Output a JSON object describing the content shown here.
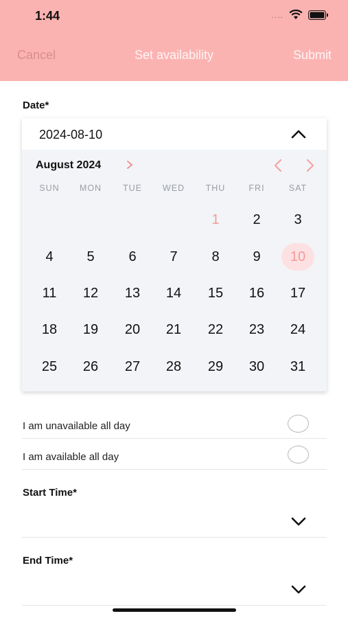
{
  "status_bar": {
    "time": "1:44",
    "dots": "....",
    "wifi_icon": "wifi-icon",
    "battery_icon": "battery-icon"
  },
  "nav": {
    "cancel": "Cancel",
    "title": "Set availability",
    "submit": "Submit"
  },
  "date": {
    "label": "Date*",
    "value": "2024-08-10",
    "month": "August 2024",
    "weekdays": [
      "SUN",
      "MON",
      "TUE",
      "WED",
      "THU",
      "FRI",
      "SAT"
    ],
    "days": [
      "1",
      "2",
      "3",
      "4",
      "5",
      "6",
      "7",
      "8",
      "9",
      "10",
      "11",
      "12",
      "13",
      "14",
      "15",
      "16",
      "17",
      "18",
      "19",
      "20",
      "21",
      "22",
      "23",
      "24",
      "25",
      "26",
      "27",
      "28",
      "29",
      "30",
      "31"
    ],
    "first_weekday": 4,
    "today_day": 1,
    "selected_day": 10
  },
  "options": [
    {
      "label": "I am unavailable all day"
    },
    {
      "label": "I am available all day"
    }
  ],
  "start_time": {
    "label": "Start Time*"
  },
  "end_time": {
    "label": "End Time*"
  },
  "colors": {
    "header": "#fbb3b2",
    "accent": "#f08f8f",
    "selected_bg": "#fde1e2"
  }
}
